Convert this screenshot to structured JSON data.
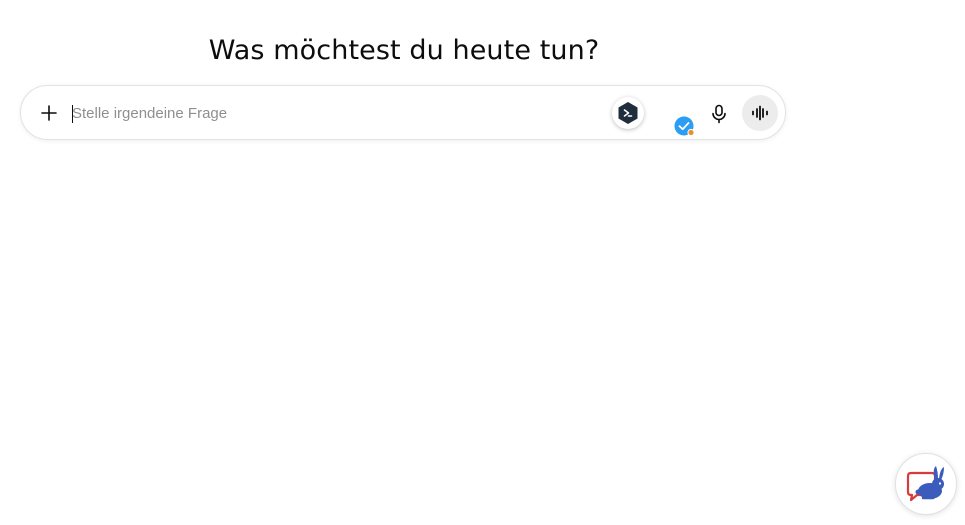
{
  "main": {
    "heading": "Was möchtest du heute tun?"
  },
  "composer": {
    "placeholder": "Stelle irgendeine Frage",
    "value": ""
  },
  "icons": {
    "add": "plus-icon",
    "extension": "hexagon-extension-icon",
    "check": "check-badge-icon",
    "mic": "microphone-icon",
    "voice": "voice-waveform-icon",
    "helper": "rabbit-chat-icon"
  },
  "colors": {
    "text": "#0d0d0d",
    "placeholder": "#8f8f8f",
    "extension_dark": "#1f2d3d",
    "check_blue": "#2a9df4",
    "status_orange": "#e8912d",
    "helper_blue": "#3b5bbd",
    "helper_red": "#d93a3a"
  }
}
